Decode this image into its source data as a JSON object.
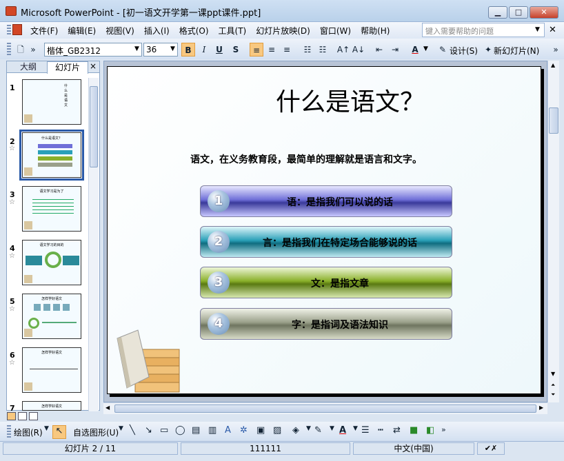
{
  "window": {
    "title": "Microsoft PowerPoint - [初一语文开学第一课ppt课件.ppt]",
    "minimize": "▁",
    "maximize": "□",
    "close": "✕"
  },
  "menu": {
    "items": [
      "文件(F)",
      "编辑(E)",
      "视图(V)",
      "插入(I)",
      "格式(O)",
      "工具(T)",
      "幻灯片放映(D)",
      "窗口(W)",
      "帮助(H)"
    ],
    "help_placeholder": "键入需要帮助的问题",
    "close": "✕"
  },
  "toolbar": {
    "font_name": "楷体_GB2312",
    "font_size": "36",
    "bold": "B",
    "italic": "I",
    "underline": "U",
    "shadow": "S",
    "design_label": "设计(S)",
    "new_slide_label": "新幻灯片(N)",
    "font_color_glyph": "A"
  },
  "pane": {
    "tab_outline": "大纲",
    "tab_slides": "幻灯片",
    "close": "×"
  },
  "thumbnails": [
    {
      "num": "1",
      "label": "什么是语文"
    },
    {
      "num": "2",
      "label": "什么是语文？"
    },
    {
      "num": "3",
      "label": "语文学习是为了"
    },
    {
      "num": "4",
      "label": "语文学习的目的"
    },
    {
      "num": "5",
      "label": "怎样学好语文"
    },
    {
      "num": "6",
      "label": "怎样学好语文"
    },
    {
      "num": "7",
      "label": "怎样学好语文"
    }
  ],
  "slide": {
    "title": "什么是语文？",
    "subtitle": "语文，在义务教育段，最简单的理解就是语言和文字。",
    "items": [
      {
        "num": "1",
        "text": "语：是指我们可以说的话"
      },
      {
        "num": "2",
        "text": "言：是指我们在特定场合能够说的话"
      },
      {
        "num": "3",
        "text": "文：是指文章"
      },
      {
        "num": "4",
        "text": "字：是指词及语法知识"
      }
    ]
  },
  "drawing": {
    "draw_label": "绘图(R)",
    "autoshape_label": "自选图形(U)"
  },
  "status": {
    "slide_info": "幻灯片 2 / 11",
    "design": "111111",
    "language": "中文(中国)"
  },
  "colors": {
    "accent": "#2a5aa8",
    "bar1": "#6f6fd8",
    "bar2": "#2aa0b8",
    "bar3": "#8ab02a",
    "bar4": "#9aa08a"
  }
}
